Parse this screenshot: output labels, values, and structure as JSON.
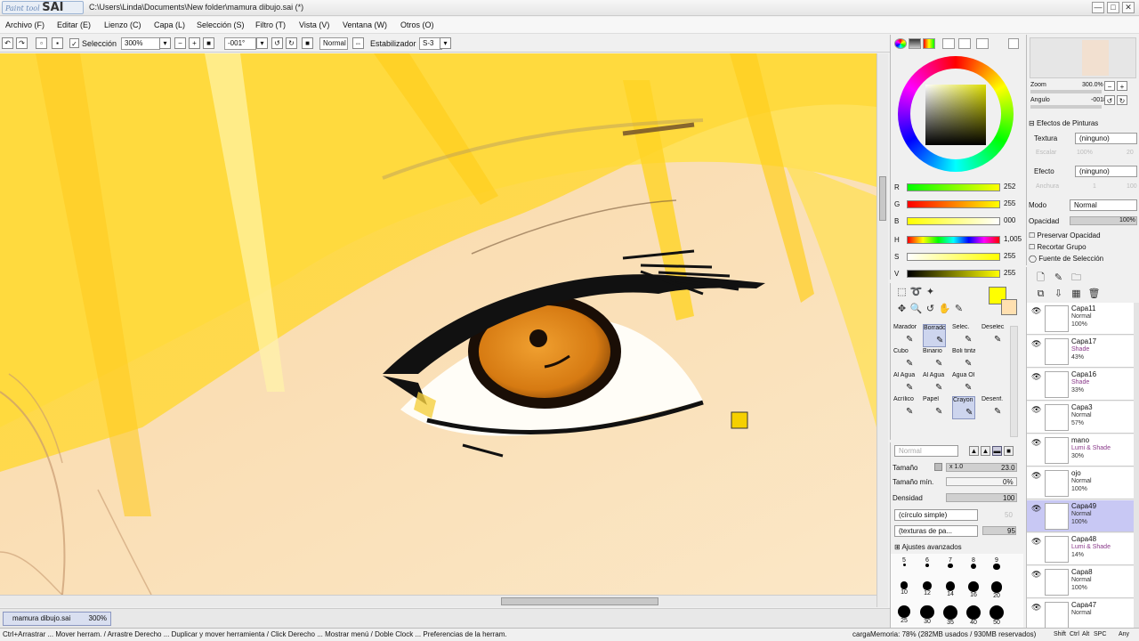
{
  "window": {
    "logo_small": "Paint tool",
    "logo_big": "SAI",
    "title": "C:\\Users\\Linda\\Documents\\New folder\\mamura dibujo.sai (*)",
    "minimize": "—",
    "maximize": "□",
    "close": "✕"
  },
  "menu": [
    "Archivo (F)",
    "Editar (E)",
    "Lienzo (C)",
    "Capa (L)",
    "Selección (S)",
    "Filtro (T)",
    "Vista (V)",
    "Ventana (W)",
    "Otros (O)"
  ],
  "toolbar": {
    "selection_label": "Selección",
    "zoom": "300%",
    "angle": "-001°",
    "blend": "Normal",
    "stabilizer_label": "Estabilizador",
    "stabilizer_value": "S-3"
  },
  "document_tab": {
    "name": "mamura dibujo.sai",
    "zoom": "300%"
  },
  "status": {
    "hint": "Ctrl+Arrastrar ... Mover herram. / Arrastre Derecho ... Duplicar y mover herramienta / Click Derecho ... Mostrar menú / Doble Clock ... Preferencias de la herram.",
    "memory": "cargaMemoria: 78% (282MB usados / 930MB reservados)",
    "indicators": [
      "Shift",
      "Ctrl",
      "Alt",
      "SPC",
      "Any"
    ]
  },
  "color": {
    "primary": "#ffff00",
    "secondary": "#ffe0b0",
    "sliders": [
      {
        "label": "R",
        "value": "252"
      },
      {
        "label": "G",
        "value": "255"
      },
      {
        "label": "B",
        "value": "000"
      },
      {
        "label": "H",
        "value": "1,005"
      },
      {
        "label": "S",
        "value": "255"
      },
      {
        "label": "V",
        "value": "255"
      }
    ]
  },
  "brushes": [
    {
      "name": "Marador",
      "icon": "pencil-icon"
    },
    {
      "name": "Borrador",
      "icon": "eraser-icon"
    },
    {
      "name": "Selec.",
      "icon": "select-brush-icon"
    },
    {
      "name": "Deselec.",
      "icon": "deselect-brush-icon"
    },
    {
      "name": "Cubo",
      "icon": "bucket-icon"
    },
    {
      "name": "Binario",
      "icon": "pencil-icon"
    },
    {
      "name": "Boli tinta",
      "icon": "pen-icon"
    },
    {
      "name": "",
      "icon": ""
    },
    {
      "name": "Al Agua 9",
      "icon": "brush-icon"
    },
    {
      "name": "Al Agua 10",
      "icon": "brush-icon"
    },
    {
      "name": "Agua Ol",
      "icon": "brush-icon"
    },
    {
      "name": "",
      "icon": ""
    },
    {
      "name": "Acrílico",
      "icon": "brush-icon"
    },
    {
      "name": "Papel",
      "icon": "brush-icon"
    },
    {
      "name": "Crayon",
      "icon": "crayon-icon"
    },
    {
      "name": "Desenf.",
      "icon": "blur-icon"
    }
  ],
  "brush_settings": {
    "mode": "Normal",
    "size_label": "Tamaño",
    "size_mult": "x 1.0",
    "size_value": "23.0",
    "min_size_label": "Tamaño mín.",
    "min_size_value": "0%",
    "density_label": "Densidad",
    "density_value": "100",
    "shape": "(círculo simple)",
    "shape_value": "50",
    "texture": "(texturas de pa...",
    "texture_value": "95",
    "advanced": "Ajustes avanzados"
  },
  "dot_presets": [
    [
      "5",
      "6",
      "7",
      "8",
      "9"
    ],
    [
      "10",
      "12",
      "14",
      "16",
      "20"
    ],
    [
      "25",
      "30",
      "35",
      "40",
      "50"
    ]
  ],
  "navigator": {
    "zoom_label": "Zoom",
    "zoom_value": "300.0%",
    "angle_label": "Angulo",
    "angle_value": "-0018"
  },
  "layer_props": {
    "header": "Efectos de Pinturas",
    "texture_label": "Textura",
    "texture_value": "(ninguno)",
    "scale_label": "Escalar",
    "scale_value": "100%",
    "scale_num": "20",
    "effect_label": "Efecto",
    "effect_value": "(ninguno)",
    "width_label": "Anchura",
    "width_value": "1",
    "width_num": "100",
    "mode_label": "Modo",
    "mode_value": "Normal",
    "opacity_label": "Opacidad",
    "opacity_value": "100%",
    "preserve": "Preservar Opacidad",
    "clip": "Recortar Grupo",
    "source": "Fuente de Selección"
  },
  "layers": [
    {
      "name": "Capa11",
      "mode": "Normal",
      "opacity": "100%",
      "shade": false,
      "selected": false
    },
    {
      "name": "Capa17",
      "mode": "Shade",
      "opacity": "43%",
      "shade": true,
      "selected": false
    },
    {
      "name": "Capa16",
      "mode": "Shade",
      "opacity": "33%",
      "shade": true,
      "selected": false
    },
    {
      "name": "Capa3",
      "mode": "Normal",
      "opacity": "57%",
      "shade": false,
      "selected": false
    },
    {
      "name": "mano",
      "mode": "Lumi & Shade",
      "opacity": "30%",
      "shade": true,
      "selected": false
    },
    {
      "name": "ojo",
      "mode": "Normal",
      "opacity": "100%",
      "shade": false,
      "selected": false
    },
    {
      "name": "Capa49",
      "mode": "Normal",
      "opacity": "100%",
      "shade": false,
      "selected": true
    },
    {
      "name": "Capa48",
      "mode": "Lumi & Shade",
      "opacity": "14%",
      "shade": true,
      "selected": false
    },
    {
      "name": "Capa8",
      "mode": "Normal",
      "opacity": "100%",
      "shade": false,
      "selected": false
    },
    {
      "name": "Capa47",
      "mode": "Normal",
      "opacity": "",
      "shade": false,
      "selected": false
    }
  ]
}
